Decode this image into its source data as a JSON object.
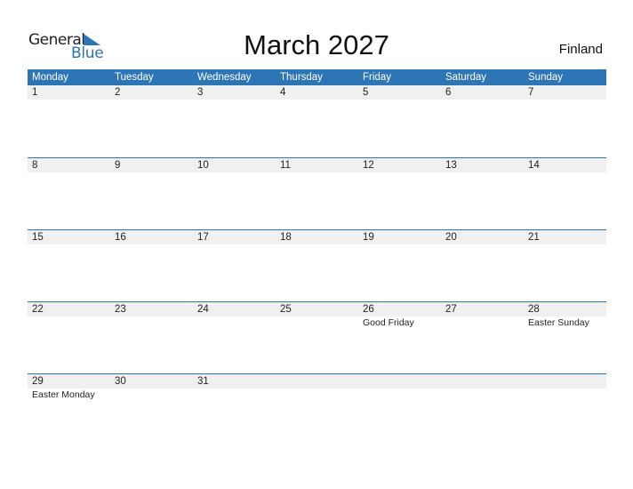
{
  "logo": {
    "word1": "General",
    "word2": "Blue"
  },
  "title": "March 2027",
  "country": "Finland",
  "colors": {
    "accent": "#2e75b6",
    "band": "#f0f0f0"
  },
  "weekdays": [
    "Monday",
    "Tuesday",
    "Wednesday",
    "Thursday",
    "Friday",
    "Saturday",
    "Sunday"
  ],
  "weeks": [
    [
      {
        "day": "1",
        "holiday": ""
      },
      {
        "day": "2",
        "holiday": ""
      },
      {
        "day": "3",
        "holiday": ""
      },
      {
        "day": "4",
        "holiday": ""
      },
      {
        "day": "5",
        "holiday": ""
      },
      {
        "day": "6",
        "holiday": ""
      },
      {
        "day": "7",
        "holiday": ""
      }
    ],
    [
      {
        "day": "8",
        "holiday": ""
      },
      {
        "day": "9",
        "holiday": ""
      },
      {
        "day": "10",
        "holiday": ""
      },
      {
        "day": "11",
        "holiday": ""
      },
      {
        "day": "12",
        "holiday": ""
      },
      {
        "day": "13",
        "holiday": ""
      },
      {
        "day": "14",
        "holiday": ""
      }
    ],
    [
      {
        "day": "15",
        "holiday": ""
      },
      {
        "day": "16",
        "holiday": ""
      },
      {
        "day": "17",
        "holiday": ""
      },
      {
        "day": "18",
        "holiday": ""
      },
      {
        "day": "19",
        "holiday": ""
      },
      {
        "day": "20",
        "holiday": ""
      },
      {
        "day": "21",
        "holiday": ""
      }
    ],
    [
      {
        "day": "22",
        "holiday": ""
      },
      {
        "day": "23",
        "holiday": ""
      },
      {
        "day": "24",
        "holiday": ""
      },
      {
        "day": "25",
        "holiday": ""
      },
      {
        "day": "26",
        "holiday": "Good Friday"
      },
      {
        "day": "27",
        "holiday": ""
      },
      {
        "day": "28",
        "holiday": "Easter Sunday"
      }
    ],
    [
      {
        "day": "29",
        "holiday": "Easter Monday"
      },
      {
        "day": "30",
        "holiday": ""
      },
      {
        "day": "31",
        "holiday": ""
      },
      {
        "day": "",
        "holiday": ""
      },
      {
        "day": "",
        "holiday": ""
      },
      {
        "day": "",
        "holiday": ""
      },
      {
        "day": "",
        "holiday": ""
      }
    ]
  ]
}
